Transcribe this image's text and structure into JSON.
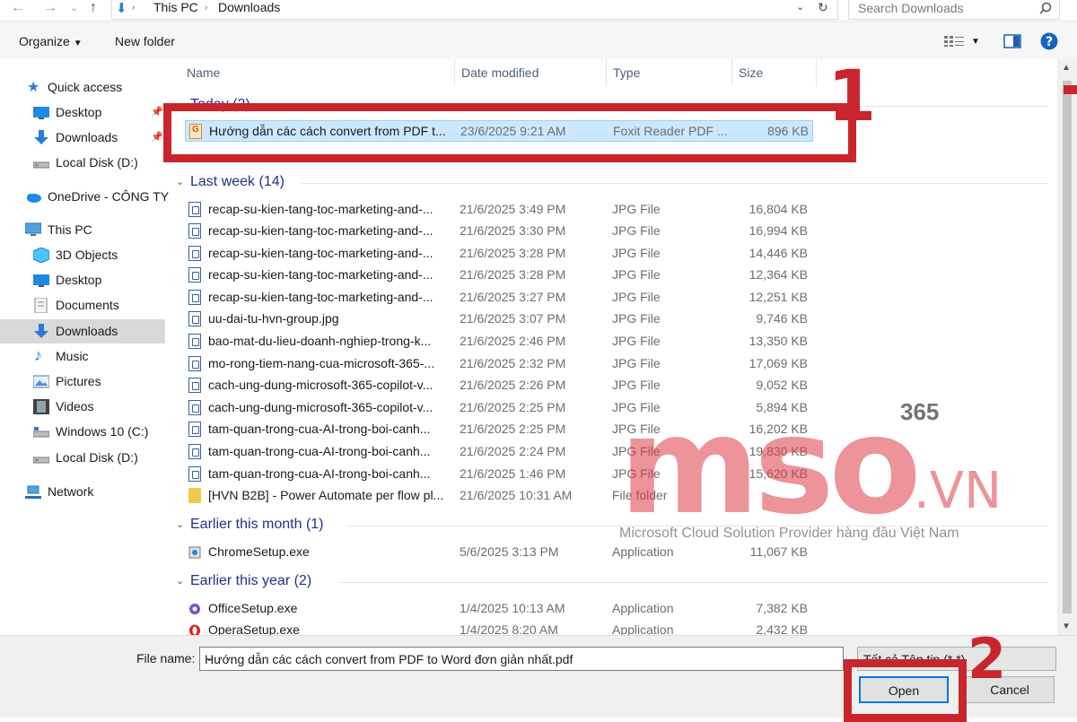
{
  "address": {
    "path": [
      "This PC",
      "Downloads"
    ],
    "search_placeholder": "Search Downloads"
  },
  "toolbar": {
    "organize": "Organize",
    "new_folder": "New folder"
  },
  "sidebar": {
    "items": [
      {
        "label": "Quick access",
        "icon": "star-icon"
      },
      {
        "label": "Desktop",
        "icon": "desktop-icon"
      },
      {
        "label": "Downloads",
        "icon": "download-arrow-icon"
      },
      {
        "label": "Local Disk (D:)",
        "icon": "drive-icon"
      },
      {
        "label": "OneDrive - CÔNG TY",
        "icon": "cloud-icon"
      },
      {
        "label": "This PC",
        "icon": "monitor-icon"
      },
      {
        "label": "3D Objects",
        "icon": "cube-icon"
      },
      {
        "label": "Desktop",
        "icon": "desktop-icon"
      },
      {
        "label": "Documents",
        "icon": "document-icon"
      },
      {
        "label": "Downloads",
        "icon": "download-arrow-icon"
      },
      {
        "label": "Music",
        "icon": "music-note-icon"
      },
      {
        "label": "Pictures",
        "icon": "picture-icon"
      },
      {
        "label": "Videos",
        "icon": "film-icon"
      },
      {
        "label": "Windows 10 (C:)",
        "icon": "drive-icon"
      },
      {
        "label": "Local Disk (D:)",
        "icon": "drive-icon"
      },
      {
        "label": "Network",
        "icon": "network-icon"
      }
    ]
  },
  "columns": {
    "name": "Name",
    "date": "Date modified",
    "type": "Type",
    "size": "Size"
  },
  "groups": {
    "today": "Today (2)",
    "last_week": "Last week (14)",
    "earlier_month": "Earlier this month (1)",
    "earlier_year": "Earlier this year (2)"
  },
  "files": {
    "today": [
      {
        "name": "Hướng dẫn các cách convert from PDF t...",
        "date": "23/6/2025 9:21 AM",
        "type": "Foxit Reader PDF ...",
        "size": "896 KB"
      }
    ],
    "last_week": [
      {
        "name": "recap-su-kien-tang-toc-marketing-and-...",
        "date": "21/6/2025 3:49 PM",
        "type": "JPG File",
        "size": "16,804 KB"
      },
      {
        "name": "recap-su-kien-tang-toc-marketing-and-...",
        "date": "21/6/2025 3:30 PM",
        "type": "JPG File",
        "size": "16,994 KB"
      },
      {
        "name": "recap-su-kien-tang-toc-marketing-and-...",
        "date": "21/6/2025 3:28 PM",
        "type": "JPG File",
        "size": "14,446 KB"
      },
      {
        "name": "recap-su-kien-tang-toc-marketing-and-...",
        "date": "21/6/2025 3:28 PM",
        "type": "JPG File",
        "size": "12,364 KB"
      },
      {
        "name": "recap-su-kien-tang-toc-marketing-and-...",
        "date": "21/6/2025 3:27 PM",
        "type": "JPG File",
        "size": "12,251 KB"
      },
      {
        "name": "uu-dai-tu-hvn-group.jpg",
        "date": "21/6/2025 3:07 PM",
        "type": "JPG File",
        "size": "9,746 KB"
      },
      {
        "name": "bao-mat-du-lieu-doanh-nghiep-trong-k...",
        "date": "21/6/2025 2:46 PM",
        "type": "JPG File",
        "size": "13,350 KB"
      },
      {
        "name": "mo-rong-tiem-nang-cua-microsoft-365-...",
        "date": "21/6/2025 2:32 PM",
        "type": "JPG File",
        "size": "17,069 KB"
      },
      {
        "name": "cach-ung-dung-microsoft-365-copilot-v...",
        "date": "21/6/2025 2:26 PM",
        "type": "JPG File",
        "size": "9,052 KB"
      },
      {
        "name": "cach-ung-dung-microsoft-365-copilot-v...",
        "date": "21/6/2025 2:25 PM",
        "type": "JPG File",
        "size": "5,894 KB"
      },
      {
        "name": "tam-quan-trong-cua-AI-trong-boi-canh...",
        "date": "21/6/2025 2:25 PM",
        "type": "JPG File",
        "size": "16,202 KB"
      },
      {
        "name": "tam-quan-trong-cua-AI-trong-boi-canh...",
        "date": "21/6/2025 2:24 PM",
        "type": "JPG File",
        "size": "19,830 KB"
      },
      {
        "name": "tam-quan-trong-cua-AI-trong-boi-canh...",
        "date": "21/6/2025 1:46 PM",
        "type": "JPG File",
        "size": "15,620 KB"
      },
      {
        "name": "[HVN B2B] - Power Automate per flow pl...",
        "date": "21/6/2025 10:31 AM",
        "type": "File folder",
        "size": ""
      }
    ],
    "earlier_month": [
      {
        "name": "ChromeSetup.exe",
        "date": "5/6/2025 3:13 PM",
        "type": "Application",
        "size": "11,067 KB"
      }
    ],
    "earlier_year": [
      {
        "name": "OfficeSetup.exe",
        "date": "1/4/2025 10:13 AM",
        "type": "Application",
        "size": "7,382 KB"
      },
      {
        "name": "OperaSetup.exe",
        "date": "1/4/2025 8:20 AM",
        "type": "Application",
        "size": "2,432 KB"
      }
    ]
  },
  "bottom": {
    "file_name_label": "File name:",
    "file_name_value": "Hướng dẫn các cách convert from PDF to Word đơn giản nhất.pdf",
    "file_type_value": "Tất cả Tệp tin (*.*)",
    "open": "Open",
    "cancel": "Cancel"
  },
  "annotations": {
    "step1": "1",
    "step2": "2"
  },
  "watermark": {
    "brand": "mso",
    "sup": "365",
    "domain": ".VN",
    "tagline": "Microsoft Cloud Solution Provider hàng đầu Việt Nam"
  },
  "colors": {
    "accent": "#0078d7",
    "annotation": "#c8262c",
    "group_title": "#1e3287",
    "selection": "#cce8ff"
  }
}
